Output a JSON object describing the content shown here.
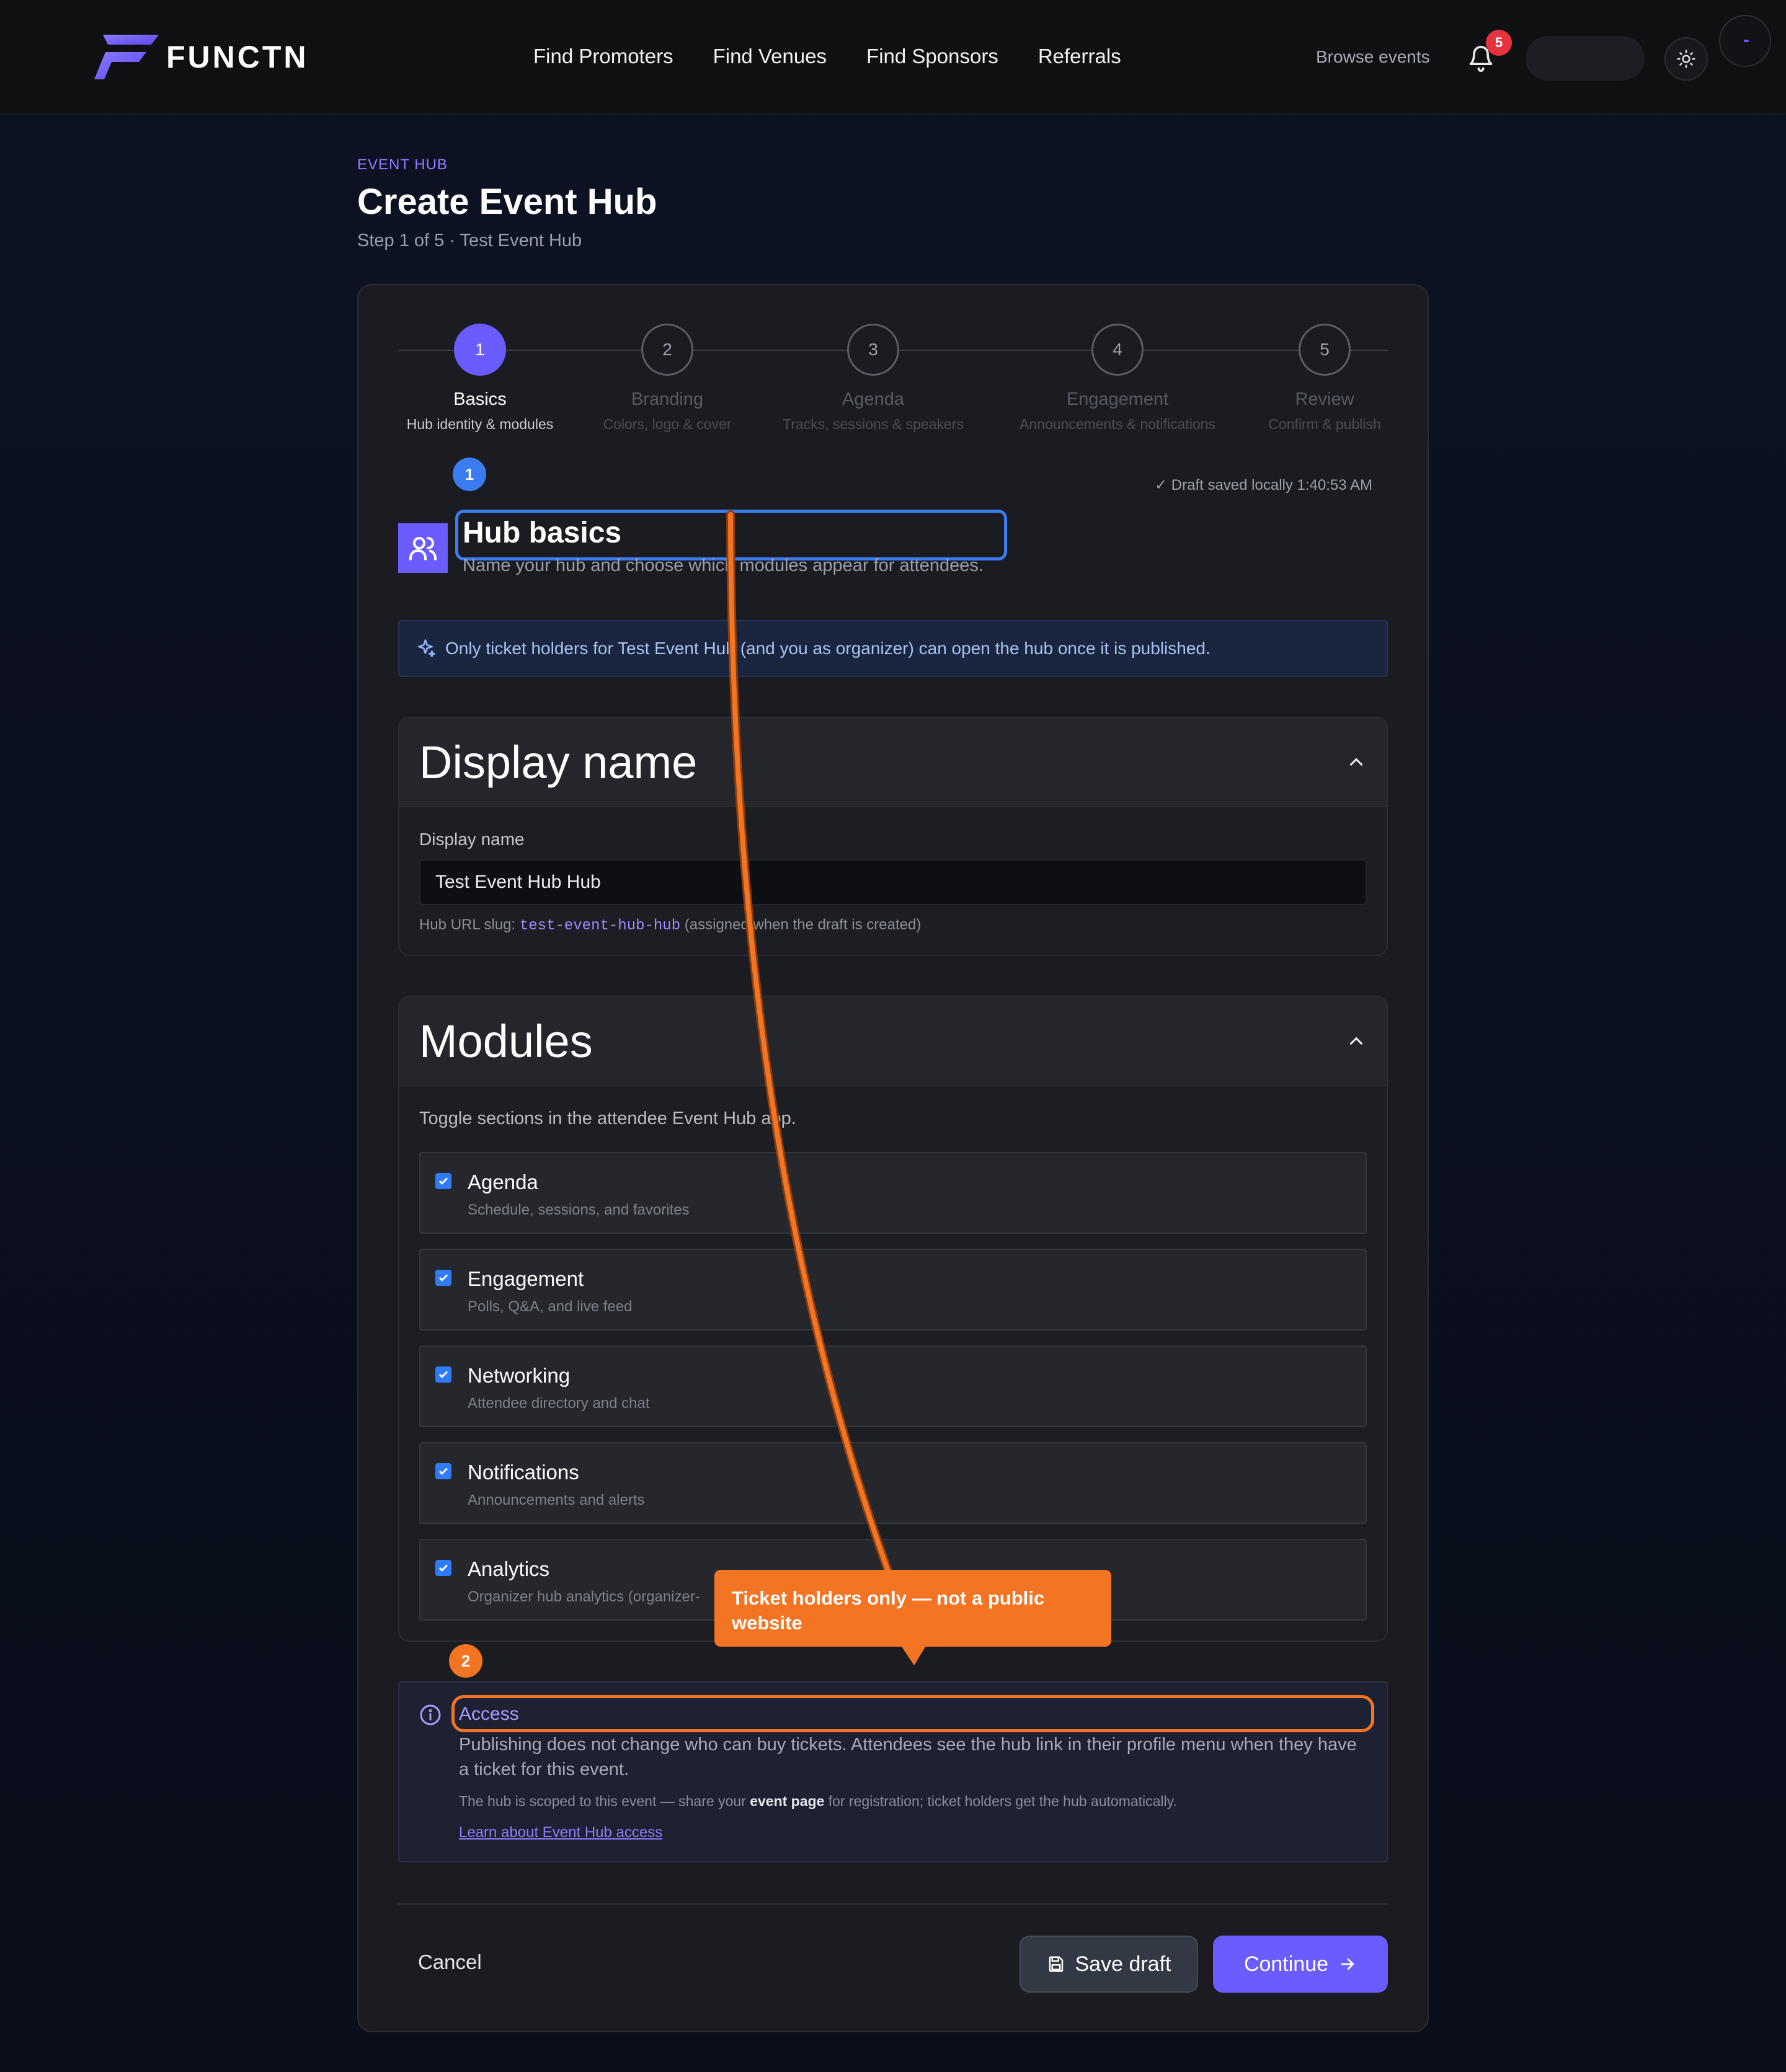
{
  "brand": {
    "name": "FUNCTN",
    "accent": "#6b5cff"
  },
  "nav": {
    "items": [
      "Find Promoters",
      "Find Venues",
      "Find Sponsors",
      "Referrals"
    ],
    "browse_events": "Browse events",
    "notifications_count": "5"
  },
  "header": {
    "eyebrow": "EVENT HUB",
    "title": "Create Event Hub",
    "subtitle": "Step 1 of 5 · Test Event Hub"
  },
  "steps": [
    {
      "number": "1",
      "label": "Basics",
      "desc": "Hub identity & modules",
      "active": true
    },
    {
      "number": "2",
      "label": "Branding",
      "desc": "Colors, logo & cover",
      "active": false
    },
    {
      "number": "3",
      "label": "Agenda",
      "desc": "Tracks, sessions & speakers",
      "active": false
    },
    {
      "number": "4",
      "label": "Engagement",
      "desc": "Announcements & notifications",
      "active": false
    },
    {
      "number": "5",
      "label": "Review",
      "desc": "Confirm & publish",
      "active": false
    }
  ],
  "annotations": {
    "marker_1": "1",
    "marker_2": "2",
    "callout": "Ticket holders only — not a public website"
  },
  "draft_status": "Draft saved locally 1:40:53 AM",
  "hub_basics": {
    "title": "Hub basics",
    "subtitle": "Name your hub and choose which modules appear for attendees.",
    "info": "Only ticket holders for Test Event Hub (and you as organizer) can open the hub once it is published."
  },
  "display_name": {
    "section_title": "Display name",
    "field_label": "Display name",
    "value": "Test Event Hub Hub",
    "slug_prefix": "Hub URL slug:",
    "slug": "test-event-hub-hub",
    "slug_suffix": "(assigned when the draft is created)"
  },
  "modules": {
    "section_title": "Modules",
    "intro": "Toggle sections in the attendee Event Hub app.",
    "items": [
      {
        "name": "Agenda",
        "desc": "Schedule, sessions, and favorites",
        "checked": true
      },
      {
        "name": "Engagement",
        "desc": "Polls, Q&A, and live feed",
        "checked": true
      },
      {
        "name": "Networking",
        "desc": "Attendee directory and chat",
        "checked": true
      },
      {
        "name": "Notifications",
        "desc": "Announcements and alerts",
        "checked": true
      },
      {
        "name": "Analytics",
        "desc": "Organizer hub analytics (organizer-",
        "checked": true
      }
    ]
  },
  "access": {
    "title": "Access",
    "body": "Publishing does not change who can buy tickets. Attendees see the hub link in their profile menu when they have a ticket for this event.",
    "note_before": "The hub is scoped to this event — share your ",
    "note_bold": "event page",
    "note_after": " for registration; ticket holders get the hub automatically.",
    "link": "Learn about Event Hub access"
  },
  "footer": {
    "cancel": "Cancel",
    "save": "Save draft",
    "continue": "Continue"
  },
  "colors": {
    "callout": "#f37423",
    "highlight": "#3b7cf0",
    "checkbox": "#2f7cf6"
  }
}
